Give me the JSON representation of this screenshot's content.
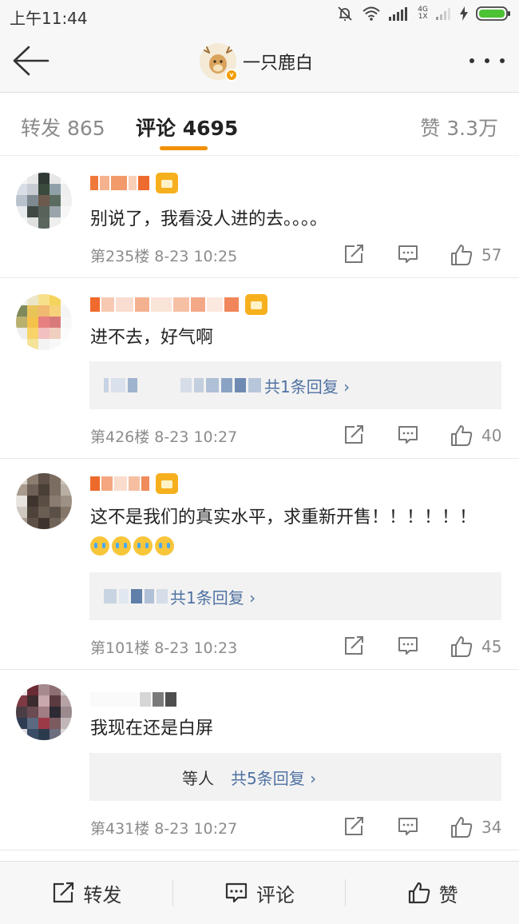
{
  "status_bar": {
    "time": "上午11:44",
    "network_label": "4G",
    "network_sub": "1X"
  },
  "header": {
    "back_icon": "back-arrow-icon",
    "username": "一只鹿白",
    "verified_badge": "v",
    "more_icon": "more-dots-icon"
  },
  "tabs": [
    {
      "label": "转发 865",
      "active": false
    },
    {
      "label": "评论 4695",
      "active": true
    },
    {
      "label": "赞 3.3万",
      "active": false
    }
  ],
  "accent_color": "#f29000",
  "link_color": "#4f72a2",
  "comments": [
    {
      "text": "别说了，我看没人进的去。。。。",
      "meta": "第235楼  8-23 10:25",
      "likes": "57",
      "reply_prefix": "",
      "reply_count": ""
    },
    {
      "text": "进不去，好气啊",
      "meta": "第426楼  8-23 10:27",
      "likes": "40",
      "reply_prefix": "",
      "reply_count": "共1条回复 ›"
    },
    {
      "text": "这不是我们的真实水平，求重新开售！！！！！！",
      "meta": "第101楼  8-23 10:23",
      "likes": "45",
      "reply_prefix": "",
      "reply_count": "共1条回复 ›"
    },
    {
      "text": "我现在还是白屏",
      "meta": "第431楼  8-23 10:27",
      "likes": "34",
      "reply_prefix": "等人",
      "reply_count": "共5条回复 ›"
    }
  ],
  "bottom_bar": {
    "repost": "转发",
    "comment": "评论",
    "like": "赞"
  }
}
